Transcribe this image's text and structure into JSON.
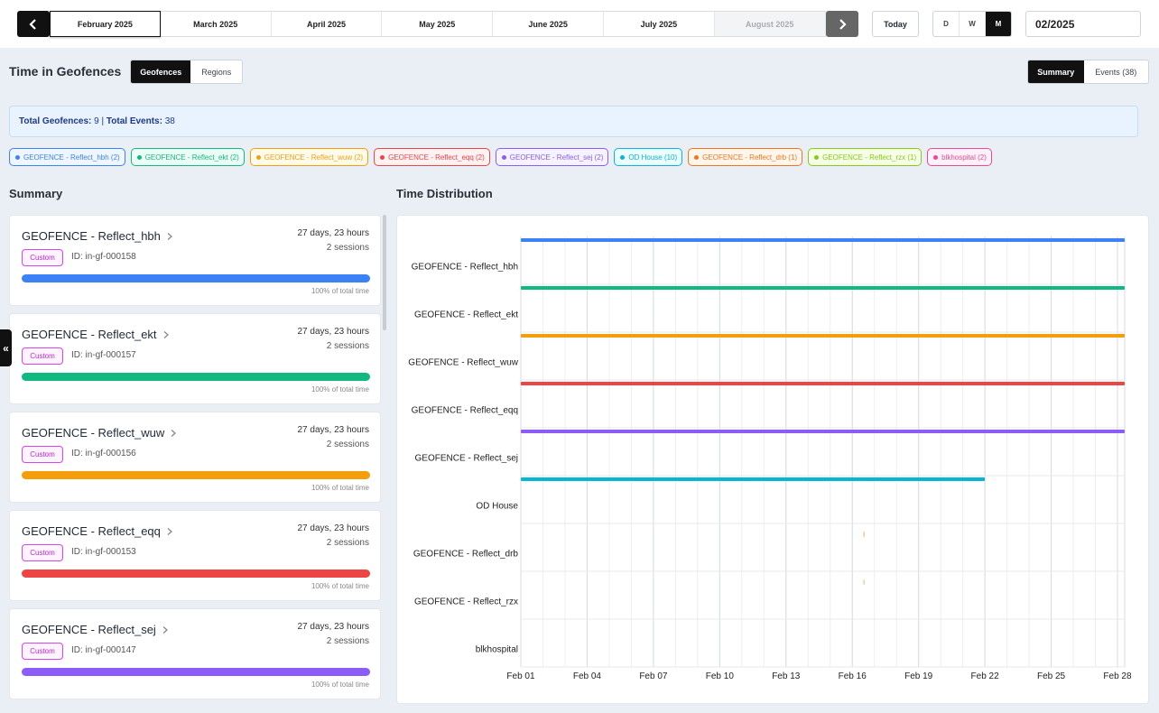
{
  "month_nav": {
    "prev_icon": "chevron-left-icon",
    "next_icon": "chevron-right-icon",
    "months": [
      {
        "label": "February 2025",
        "state": "active"
      },
      {
        "label": "March 2025",
        "state": "normal"
      },
      {
        "label": "April 2025",
        "state": "normal"
      },
      {
        "label": "May 2025",
        "state": "normal"
      },
      {
        "label": "June 2025",
        "state": "normal"
      },
      {
        "label": "July 2025",
        "state": "normal"
      },
      {
        "label": "August 2025",
        "state": "disabled"
      }
    ],
    "today_label": "Today",
    "view_modes": [
      "D",
      "W",
      "M"
    ],
    "active_view_mode": "M",
    "date_value": "02/2025"
  },
  "header": {
    "title": "Time in Geofences",
    "scope_tabs": [
      "Geofences",
      "Regions"
    ],
    "active_scope": "Geofences",
    "view_tabs": [
      "Summary",
      "Events (38)"
    ],
    "active_view": "Summary"
  },
  "totals": {
    "geofences_label": "Total Geofences:",
    "geofences_value": "9",
    "separator": "|",
    "events_label": "Total Events:",
    "events_value": "38"
  },
  "chips": [
    {
      "label": "GEOFENCE - Reflect_hbh (2)",
      "color": "#3b82f6",
      "bg": "#eff6ff"
    },
    {
      "label": "GEOFENCE - Reflect_ekt (2)",
      "color": "#10b981",
      "bg": "#ecfdf5"
    },
    {
      "label": "GEOFENCE - Reflect_wuw (2)",
      "color": "#f59e0b",
      "bg": "#fffbeb"
    },
    {
      "label": "GEOFENCE - Reflect_eqq (2)",
      "color": "#ef4444",
      "bg": "#fef2f2"
    },
    {
      "label": "GEOFENCE - Reflect_sej (2)",
      "color": "#8b5cf6",
      "bg": "#f5f3ff"
    },
    {
      "label": "OD House (10)",
      "color": "#06b6d4",
      "bg": "#ecfeff"
    },
    {
      "label": "GEOFENCE - Reflect_drb (1)",
      "color": "#f97316",
      "bg": "#fff7ed"
    },
    {
      "label": "GEOFENCE - Reflect_rzx (1)",
      "color": "#84cc16",
      "bg": "#f7fee7"
    },
    {
      "label": "blkhospital (2)",
      "color": "#ec4899",
      "bg": "#fdf2f8"
    }
  ],
  "summary": {
    "title": "Summary",
    "tag_label": "Custom",
    "cards": [
      {
        "name": "GEOFENCE - Reflect_hbh",
        "id": "ID: in-gf-000158",
        "duration": "27 days, 23 hours",
        "sessions": "2 sessions",
        "share": 1.0,
        "share_label": "100% of total time",
        "color": "#3b82f6"
      },
      {
        "name": "GEOFENCE - Reflect_ekt",
        "id": "ID: in-gf-000157",
        "duration": "27 days, 23 hours",
        "sessions": "2 sessions",
        "share": 1.0,
        "share_label": "100% of total time",
        "color": "#10b981"
      },
      {
        "name": "GEOFENCE - Reflect_wuw",
        "id": "ID: in-gf-000156",
        "duration": "27 days, 23 hours",
        "sessions": "2 sessions",
        "share": 1.0,
        "share_label": "100% of total time",
        "color": "#f59e0b"
      },
      {
        "name": "GEOFENCE - Reflect_eqq",
        "id": "ID: in-gf-000153",
        "duration": "27 days, 23 hours",
        "sessions": "2 sessions",
        "share": 1.0,
        "share_label": "100% of total time",
        "color": "#ef4444"
      },
      {
        "name": "GEOFENCE - Reflect_sej",
        "id": "ID: in-gf-000147",
        "duration": "27 days, 23 hours",
        "sessions": "2 sessions",
        "share": 1.0,
        "share_label": "100% of total time",
        "color": "#8b5cf6"
      }
    ]
  },
  "distribution": {
    "title": "Time Distribution"
  },
  "chart_data": {
    "type": "bar",
    "orientation": "horizontal-timeline",
    "x_ticks": [
      "Feb 01",
      "Feb 04",
      "Feb 07",
      "Feb 10",
      "Feb 13",
      "Feb 16",
      "Feb 19",
      "Feb 22",
      "Feb 25",
      "Feb 28"
    ],
    "xlim_days": [
      1,
      28
    ],
    "grid": true,
    "categories": [
      "GEOFENCE - Reflect_hbh",
      "GEOFENCE - Reflect_ekt",
      "GEOFENCE - Reflect_wuw",
      "GEOFENCE - Reflect_eqq",
      "GEOFENCE - Reflect_sej",
      "OD House",
      "GEOFENCE - Reflect_drb",
      "GEOFENCE - Reflect_rzx",
      "blkhospital"
    ],
    "series": [
      {
        "category": "GEOFENCE - Reflect_hbh",
        "start_day": 1,
        "end_day": 28.9,
        "color": "#3b82f6"
      },
      {
        "category": "GEOFENCE - Reflect_ekt",
        "start_day": 1,
        "end_day": 28.9,
        "color": "#10b981"
      },
      {
        "category": "GEOFENCE - Reflect_wuw",
        "start_day": 1,
        "end_day": 28.9,
        "color": "#f59e0b"
      },
      {
        "category": "GEOFENCE - Reflect_eqq",
        "start_day": 1,
        "end_day": 28.9,
        "color": "#ef4444"
      },
      {
        "category": "GEOFENCE - Reflect_sej",
        "start_day": 1,
        "end_day": 28.9,
        "color": "#8b5cf6"
      },
      {
        "category": "OD House",
        "start_day": 1,
        "end_day": 22.0,
        "color": "#06b6d4"
      },
      {
        "category": "GEOFENCE - Reflect_drb",
        "start_day": 16.5,
        "end_day": 16.55,
        "color": "#f97316"
      },
      {
        "category": "GEOFENCE - Reflect_rzx",
        "start_day": 16.5,
        "end_day": 16.55,
        "color": "#84cc16"
      },
      {
        "category": "blkhospital",
        "start_day": null,
        "end_day": null,
        "color": "#ec4899"
      }
    ]
  }
}
